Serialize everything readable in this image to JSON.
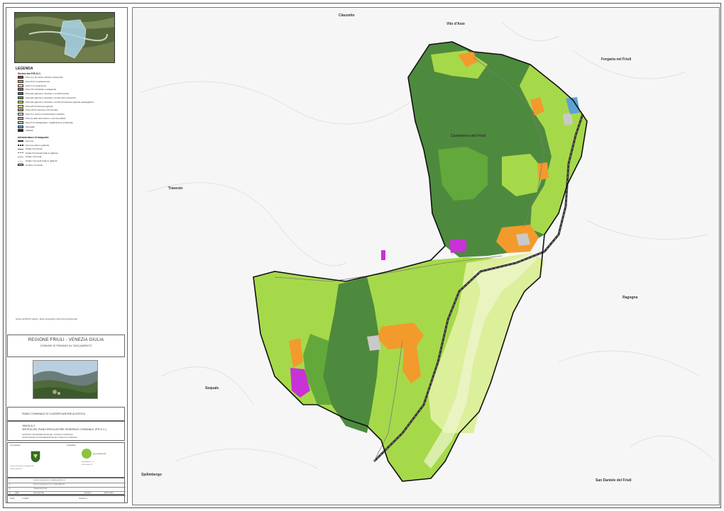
{
  "legend": {
    "title": "LEGENDA",
    "zones_header": "Sintesi del P.R.G.C.",
    "zones": [
      {
        "color": "#d62a1e",
        "label": "Zona A e Ab storico-artistico ambientale"
      },
      {
        "color": "#f39a2d",
        "label": "Zona B di completamento"
      },
      {
        "color": "#f7ef6a",
        "label": "Zona C di espansione"
      },
      {
        "color": "#c832d6",
        "label": "Zona D1 industriale e artigianale"
      },
      {
        "color": "#3f7f3a",
        "label": "Zona E2 agricola e forestale in ambiti boschivi"
      },
      {
        "color": "#63a83a",
        "label": "Zona E3 agricola e forestale in ambiti silvo-zootecnici"
      },
      {
        "color": "#a6d94a",
        "label": "Zona E4 agricola e forestale in ambiti di interesse agricolo-paesaggistico"
      },
      {
        "color": "#dcef9a",
        "label": "Zona E6 di interesse agricolo"
      },
      {
        "color": "#c2a56b",
        "label": "Zona H2 di interesse commerciale"
      },
      {
        "color": "#d8d8d8",
        "label": "Zona S e servizi ed attrezzature collettive"
      },
      {
        "color": "#b7b7b7",
        "label": "Zona Q delle attrezzature e servizi pubblici"
      },
      {
        "color": "#b9c6a7",
        "label": "Zona P di salvaguardia - qualificazione ambientale"
      },
      {
        "color": "#5ca3d3",
        "label": "Idrografia"
      },
      {
        "color": "#2a2a2a",
        "label": "Viabilità"
      }
    ],
    "infra_header": "Infrastrutture di trasporto",
    "infra": [
      {
        "style": "rail",
        "label": "Ferrovia"
      },
      {
        "style": "rail-tunnel",
        "label": "Ferrovia (tratti in galleria)"
      },
      {
        "style": "road",
        "label": "Strade Provinciali"
      },
      {
        "style": "road-tunnel",
        "label": "Strade Provinciali (tratti in galleria)"
      },
      {
        "style": "local",
        "label": "Strade Comunali"
      },
      {
        "style": "local-tunnel",
        "label": "Strade Comunali (tratti in galleria)"
      },
      {
        "style": "border",
        "label": "Confine comunale"
      }
    ]
  },
  "note": "Sintesi del PRGC vigente - Base cartografica Carta Tecnica Regionale",
  "title_block": {
    "region": "REGIONE FRIULI - VENEZIA GIULIA",
    "municipality": "COMUNE DI PINZANO AL TAGLIAMENTO",
    "plan": "PIANO COMUNALE DI CLASSIFICAZIONE ACUSTICA",
    "tavola": "TAVOLA 2",
    "tavola_desc": "SINTESI DEL PIANO REGOLATORE GENERALE COMUNALE (P.R.G.C.)",
    "approval1": "ADOZIONE CON DELIBERAZIONE DEL CONSIGLIO COMUNALE",
    "approval2": "APPROVAZIONE CON DELIBERAZIONE DEL CONSIGLIO COMUNALE"
  },
  "firm": {
    "client_label": "Committente",
    "designer_label": "Progettista",
    "designer_name": "geoambiente",
    "client_lines": [
      "Comune di Pinzano al Tagliamento",
      "Piazza Lepanto, 1"
    ],
    "designer_lines": [
      "geoambiente s.r.l.",
      "Via Ferrovia, 37"
    ]
  },
  "revisions": [
    {
      "n": "C",
      "date": "",
      "desc": "MODIFICHE A SEGUITO PARERE ARPA FVG",
      "a": "",
      "b": ""
    },
    {
      "n": "B",
      "date": "",
      "desc": "MODIFICHE A SEGUITO DI OSSERVAZIONI",
      "a": "",
      "b": ""
    },
    {
      "n": "A",
      "date": "",
      "desc": "PRIMA EMISSIONE",
      "a": "",
      "b": ""
    },
    {
      "n": "N",
      "date": "DATA",
      "desc": "DESCRIZIONE",
      "a": "REDATTO",
      "b": "APPROVATO"
    }
  ],
  "scale": {
    "label": "Scala",
    "value": "1:10000",
    "sheet": "TAVOLA 2"
  },
  "places": [
    {
      "name": "Clauzetto"
    },
    {
      "name": "Vito d'Asio"
    },
    {
      "name": "Forgaria nel Friuli"
    },
    {
      "name": "Castelnovo del Friuli"
    },
    {
      "name": "Travesio"
    },
    {
      "name": "Ragogna"
    },
    {
      "name": "Sequals"
    },
    {
      "name": "Spilimbergo"
    },
    {
      "name": "San Daniele del Friuli"
    }
  ]
}
